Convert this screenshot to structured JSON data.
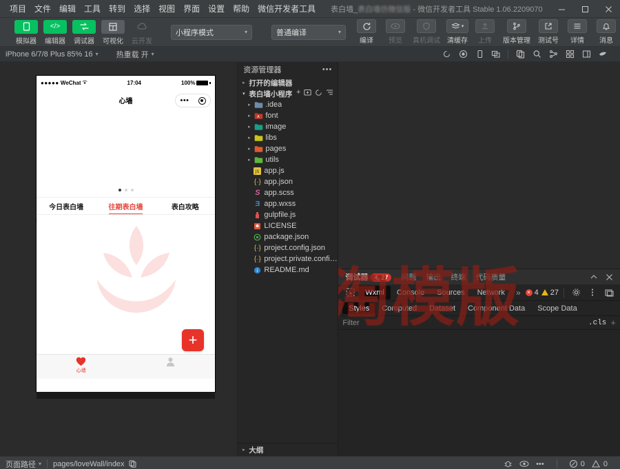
{
  "titlebar": {
    "menus": [
      "项目",
      "文件",
      "编辑",
      "工具",
      "转到",
      "选择",
      "视图",
      "界面",
      "设置",
      "帮助",
      "微信开发者工具"
    ],
    "window_title_prefix": "表白墙_",
    "window_title_blurred": "表白墙仿微信版",
    "window_title_suffix": " - 微信开发者工具 Stable 1.06.2209070",
    "minimize_icon": "minimize-icon",
    "maximize_icon": "maximize-icon",
    "close_icon": "close-icon"
  },
  "toolbar": {
    "avatar_icon": "avatar-icon",
    "left_buttons": [
      {
        "label": "模拟器",
        "icon": "phone-icon",
        "style": "green",
        "active": true
      },
      {
        "label": "编辑器",
        "icon": "code-icon",
        "style": "green",
        "active": true
      },
      {
        "label": "调试器",
        "icon": "debug-icon",
        "style": "green",
        "active": true
      },
      {
        "label": "可视化",
        "icon": "grid-icon",
        "style": "grey",
        "active": false
      },
      {
        "label": "云开发",
        "icon": "cloud-icon",
        "style": "plain",
        "active": false
      }
    ],
    "mode_select": {
      "value": "小程序模式",
      "caret": "▾"
    },
    "compile_select": {
      "value": "普通编译",
      "caret": "▾"
    },
    "center_buttons": [
      {
        "label": "编译",
        "icon": "refresh-icon",
        "dim": false
      },
      {
        "label": "预览",
        "icon": "qrcode-icon",
        "dim": true
      },
      {
        "label": "真机调试",
        "icon": "device-icon",
        "dim": true
      },
      {
        "label": "清缓存",
        "icon": "layers-icon",
        "dim": false,
        "caret": "▾"
      }
    ],
    "right_buttons": [
      {
        "label": "上传",
        "icon": "upload-icon",
        "dim": true
      },
      {
        "label": "版本管理",
        "icon": "branch-icon",
        "dim": false
      },
      {
        "label": "测试号",
        "icon": "external-icon",
        "dim": false
      },
      {
        "label": "详情",
        "icon": "menu-icon",
        "dim": false
      },
      {
        "label": "消息",
        "icon": "bell-icon",
        "dim": false
      }
    ]
  },
  "simbar": {
    "device": "iPhone 6/7/8 Plus 85% 16",
    "device_caret": "▾",
    "hotreload": "热重载 开",
    "hotreload_caret": "▾",
    "icons": [
      "rotate-icon",
      "record-icon",
      "device-frame-icon",
      "multiscreen-icon",
      "copy-icon",
      "search-icon",
      "tree-icon",
      "apps-icon",
      "panel-icon",
      "pointer-icon"
    ]
  },
  "simulator": {
    "status": {
      "carrier": "WeChat",
      "signal_dots": "●●●●●",
      "wifi_icon": "wifi-icon",
      "time": "17:04",
      "battery": "100%"
    },
    "nav_title": "心墙",
    "capsule": {
      "dots_icon": "more-dots-icon",
      "target_icon": "target-icon"
    },
    "swiper_dots": 3,
    "swiper_active_index": 0,
    "tabs": [
      {
        "label": "今日表白墙",
        "active": false
      },
      {
        "label": "往期表白墙",
        "active": true
      },
      {
        "label": "表白攻略",
        "active": false
      }
    ],
    "line_marker": "2",
    "fab": {
      "icon": "plus-icon",
      "color": "#e8332a"
    },
    "tabbar": [
      {
        "label": "心墙",
        "icon": "heart-icon",
        "active": true
      },
      {
        "label": "",
        "icon": "user-icon",
        "active": false
      }
    ]
  },
  "explorer": {
    "title": "资源管理器",
    "more_icon": "more-icon",
    "open_editors": {
      "label": "打开的编辑器",
      "arrow": "▸"
    },
    "project": {
      "label": "表白墙小程序",
      "arrow": "▾",
      "actions": [
        "new-file-icon",
        "new-folder-icon",
        "refresh-icon",
        "collapse-icon"
      ]
    },
    "folders": [
      {
        "name": ".idea",
        "color": "#6d8ca8",
        "arrow": "▸"
      },
      {
        "name": "font",
        "color": "#c0392b",
        "arrow": "▸"
      },
      {
        "name": "image",
        "color": "#16a085",
        "arrow": "▸"
      },
      {
        "name": "libs",
        "color": "#c9c617",
        "arrow": "▸"
      },
      {
        "name": "pages",
        "color": "#e05a2b",
        "arrow": "▸"
      },
      {
        "name": "utils",
        "color": "#5cb83c",
        "arrow": "▸"
      }
    ],
    "files": [
      {
        "name": "app.js",
        "icon": "js-icon",
        "color": "#e0c341"
      },
      {
        "name": "app.json",
        "icon": "json-icon",
        "color": "#d6b94c"
      },
      {
        "name": "app.scss",
        "icon": "sass-icon",
        "color": "#cf649a"
      },
      {
        "name": "app.wxss",
        "icon": "css-icon",
        "color": "#3c8ed6"
      },
      {
        "name": "gulpfile.js",
        "icon": "gulp-icon",
        "color": "#d9534f"
      },
      {
        "name": "LICENSE",
        "icon": "license-icon",
        "color": "#e0563a"
      },
      {
        "name": "package.json",
        "icon": "npm-icon",
        "color": "#4caf50"
      },
      {
        "name": "project.config.json",
        "icon": "json-icon",
        "color": "#d6b94c"
      },
      {
        "name": "project.private.config.js...",
        "icon": "json-icon",
        "color": "#d6b94c"
      },
      {
        "name": "README.md",
        "icon": "markdown-icon",
        "color": "#2f86d4"
      }
    ],
    "outline": {
      "label": "大纲",
      "arrow": "▸"
    }
  },
  "devtools": {
    "header_tabs": [
      {
        "label": "调试器",
        "active": true,
        "badge": "4, 27"
      },
      {
        "label": "问题",
        "active": false
      },
      {
        "label": "输出",
        "active": false
      },
      {
        "label": "终端",
        "active": false
      },
      {
        "label": "代码质量",
        "active": false
      }
    ],
    "header_actions": [
      "collapse-icon",
      "close-icon"
    ],
    "picker_icon": "inspect-icon",
    "panel_tabs": [
      {
        "label": "Wxml",
        "active": true
      },
      {
        "label": "Console",
        "active": false
      },
      {
        "label": "Sources",
        "active": false
      },
      {
        "label": "Network",
        "active": false
      },
      {
        "label": "»",
        "active": false
      }
    ],
    "error_count": "4",
    "warning_count": "27",
    "panel_actions": [
      "gear-icon",
      "kebab-icon",
      "dock-icon"
    ],
    "style_tabs": [
      {
        "label": "Styles",
        "active": true
      },
      {
        "label": "Computed",
        "active": false
      },
      {
        "label": "Dataset",
        "active": false
      },
      {
        "label": "Component Data",
        "active": false
      },
      {
        "label": "Scope Data",
        "active": false
      }
    ],
    "filter_placeholder": "Filter",
    "cls_label": ".cls",
    "add_rule_icon": "plus-icon"
  },
  "statusbar": {
    "page_path_label": "页面路径",
    "page_path_caret": "▾",
    "page_path_value": "pages/loveWall/index",
    "copy_icon": "copy-icon",
    "right_icons": [
      "bug-icon",
      "eye-icon",
      "ellipsis-icon"
    ],
    "error_count": "0",
    "warning_count": "0"
  },
  "watermark": {
    "text": "一淘模版",
    "color": "#8a1f16"
  }
}
